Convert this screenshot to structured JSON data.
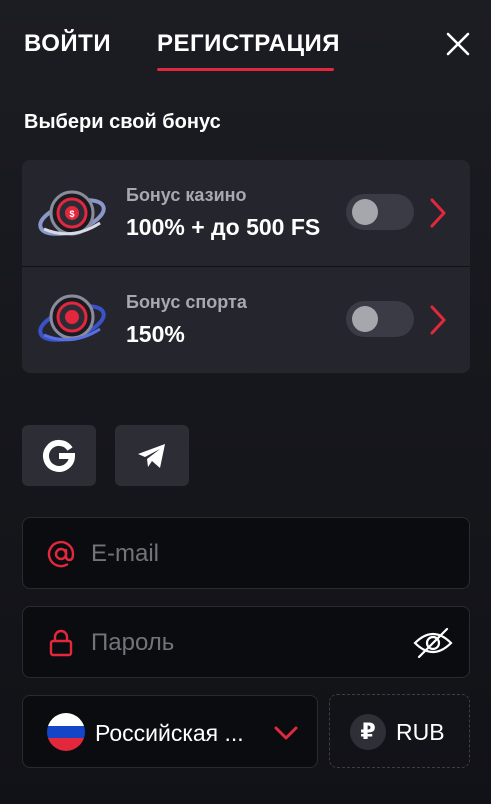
{
  "tabs": {
    "login": "ВОЙТИ",
    "register": "РЕГИСТРАЦИЯ",
    "active": "register"
  },
  "bonus": {
    "title": "Выбери свой бонус",
    "items": [
      {
        "label": "Бонус казино",
        "value": "100% + до 500 FS",
        "enabled": false,
        "image": "casino-bonus-logo"
      },
      {
        "label": "Бонус спорта",
        "value": "150%",
        "enabled": false,
        "image": "sport-bonus-logo"
      }
    ]
  },
  "social": [
    {
      "name": "google",
      "icon": "google-icon"
    },
    {
      "name": "telegram",
      "icon": "telegram-icon"
    }
  ],
  "form": {
    "email": {
      "placeholder": "E-mail",
      "icon": "at-icon"
    },
    "password": {
      "placeholder": "Пароль",
      "icon": "lock-icon",
      "toggle_icon": "eye-off-icon"
    },
    "country": {
      "value": "Российская ...",
      "flag": "russia-flag-icon"
    },
    "currency": {
      "code": "RUB",
      "symbol": "₽"
    }
  },
  "colors": {
    "accent": "#e3283e",
    "background": "#17181d",
    "card": "#25262d",
    "input": "#0b0c10",
    "muted_text": "#a8a9b0"
  }
}
